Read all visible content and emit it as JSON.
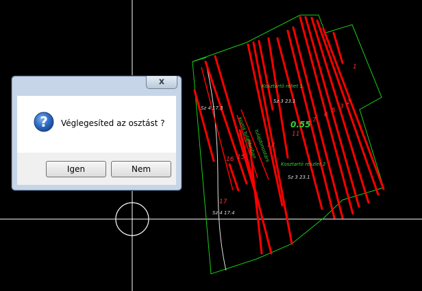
{
  "canvas": {
    "colors": {
      "background": "#000000",
      "crosshair": "#ffffff",
      "parcel_boundary": "#19d019",
      "division_lines": "#ff0000",
      "labels_green": "#3cd03c",
      "labels_white": "#dcdcdc"
    },
    "labels": {
      "parcel_1": "1",
      "parcel_2": "2",
      "parcel_3": "3",
      "parcel_5": "5",
      "parcel_6": "6",
      "parcel_7": "7",
      "parcel_13": "13",
      "parcel_15": "15",
      "parcel_16": "16",
      "parcel_17": "17",
      "sz_4_top": "Sz 4 17.3",
      "sz_4_bottom": "Sz 4 17.4",
      "sz_3_top": "Sz 3 23.1",
      "sz_3_mid": "Sz 3 23.1",
      "koszt_top": "Kosztartó réliet 1.",
      "koszt_mid": "Kosztartó részlet 2",
      "area_value": "0.55",
      "area_small": "11",
      "diag_1": "tulajdonostárs",
      "diag_2": "kozos tulajdonban"
    }
  },
  "dialog": {
    "close_label": "x",
    "message": "Véglegesíted az osztást ?",
    "icon": "question-icon",
    "yes_label": "Igen",
    "no_label": "Nem"
  }
}
